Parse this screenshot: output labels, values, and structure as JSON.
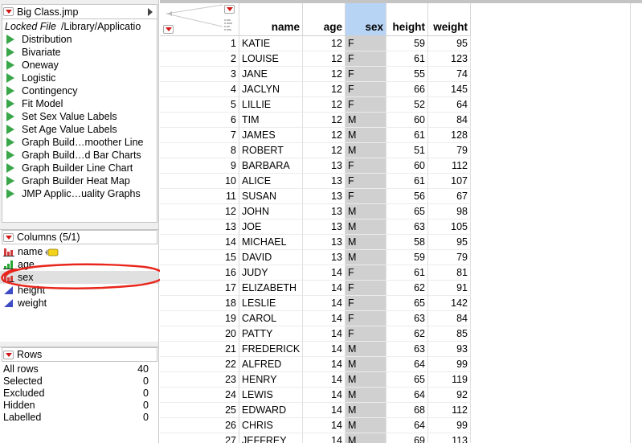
{
  "table_panel": {
    "title": "Big Class.jmp",
    "locked_label": "Locked File",
    "path": "/Library/Applicatio",
    "scripts": [
      "Distribution",
      "Bivariate",
      "Oneway",
      "Logistic",
      "Contingency",
      "Fit Model",
      "Set Sex Value Labels",
      "Set Age Value Labels",
      "Graph Build…moother Line",
      "Graph Build…d Bar Charts",
      "Graph Builder Line Chart",
      "Graph Builder Heat Map",
      "JMP Applic…uality Graphs"
    ]
  },
  "columns_panel": {
    "title": "Columns (5/1)",
    "items": [
      {
        "name": "name",
        "type": "nominal"
      },
      {
        "name": "age",
        "type": "ordinal"
      },
      {
        "name": "sex",
        "type": "nominal",
        "selected": true
      },
      {
        "name": "height",
        "type": "continuous"
      },
      {
        "name": "weight",
        "type": "continuous"
      }
    ]
  },
  "rows_panel": {
    "title": "Rows",
    "items": [
      {
        "label": "All rows",
        "value": "40"
      },
      {
        "label": "Selected",
        "value": "0"
      },
      {
        "label": "Excluded",
        "value": "0"
      },
      {
        "label": "Hidden",
        "value": "0"
      },
      {
        "label": "Labelled",
        "value": "0"
      }
    ]
  },
  "grid": {
    "headers": [
      "name",
      "age",
      "sex",
      "height",
      "weight"
    ],
    "selected_header": "sex",
    "rows": [
      [
        "1",
        "KATIE",
        "12",
        "F",
        "59",
        "95"
      ],
      [
        "2",
        "LOUISE",
        "12",
        "F",
        "61",
        "123"
      ],
      [
        "3",
        "JANE",
        "12",
        "F",
        "55",
        "74"
      ],
      [
        "4",
        "JACLYN",
        "12",
        "F",
        "66",
        "145"
      ],
      [
        "5",
        "LILLIE",
        "12",
        "F",
        "52",
        "64"
      ],
      [
        "6",
        "TIM",
        "12",
        "M",
        "60",
        "84"
      ],
      [
        "7",
        "JAMES",
        "12",
        "M",
        "61",
        "128"
      ],
      [
        "8",
        "ROBERT",
        "12",
        "M",
        "51",
        "79"
      ],
      [
        "9",
        "BARBARA",
        "13",
        "F",
        "60",
        "112"
      ],
      [
        "10",
        "ALICE",
        "13",
        "F",
        "61",
        "107"
      ],
      [
        "11",
        "SUSAN",
        "13",
        "F",
        "56",
        "67"
      ],
      [
        "12",
        "JOHN",
        "13",
        "M",
        "65",
        "98"
      ],
      [
        "13",
        "JOE",
        "13",
        "M",
        "63",
        "105"
      ],
      [
        "14",
        "MICHAEL",
        "13",
        "M",
        "58",
        "95"
      ],
      [
        "15",
        "DAVID",
        "13",
        "M",
        "59",
        "79"
      ],
      [
        "16",
        "JUDY",
        "14",
        "F",
        "61",
        "81"
      ],
      [
        "17",
        "ELIZABETH",
        "14",
        "F",
        "62",
        "91"
      ],
      [
        "18",
        "LESLIE",
        "14",
        "F",
        "65",
        "142"
      ],
      [
        "19",
        "CAROL",
        "14",
        "F",
        "63",
        "84"
      ],
      [
        "20",
        "PATTY",
        "14",
        "F",
        "62",
        "85"
      ],
      [
        "21",
        "FREDERICK",
        "14",
        "M",
        "63",
        "93"
      ],
      [
        "22",
        "ALFRED",
        "14",
        "M",
        "64",
        "99"
      ],
      [
        "23",
        "HENRY",
        "14",
        "M",
        "65",
        "119"
      ],
      [
        "24",
        "LEWIS",
        "14",
        "M",
        "64",
        "92"
      ],
      [
        "25",
        "EDWARD",
        "14",
        "M",
        "68",
        "112"
      ],
      [
        "26",
        "CHRIS",
        "14",
        "M",
        "64",
        "99"
      ],
      [
        "27",
        "JEFFREY",
        "14",
        "M",
        "69",
        "113"
      ]
    ]
  },
  "colors": {
    "accent_red": "#d01818",
    "script_green": "#3aa64a",
    "selected_header_blue": "#b8d4f4",
    "selected_column_gray": "#d0d0d0",
    "annotation_red": "#e8261c"
  }
}
